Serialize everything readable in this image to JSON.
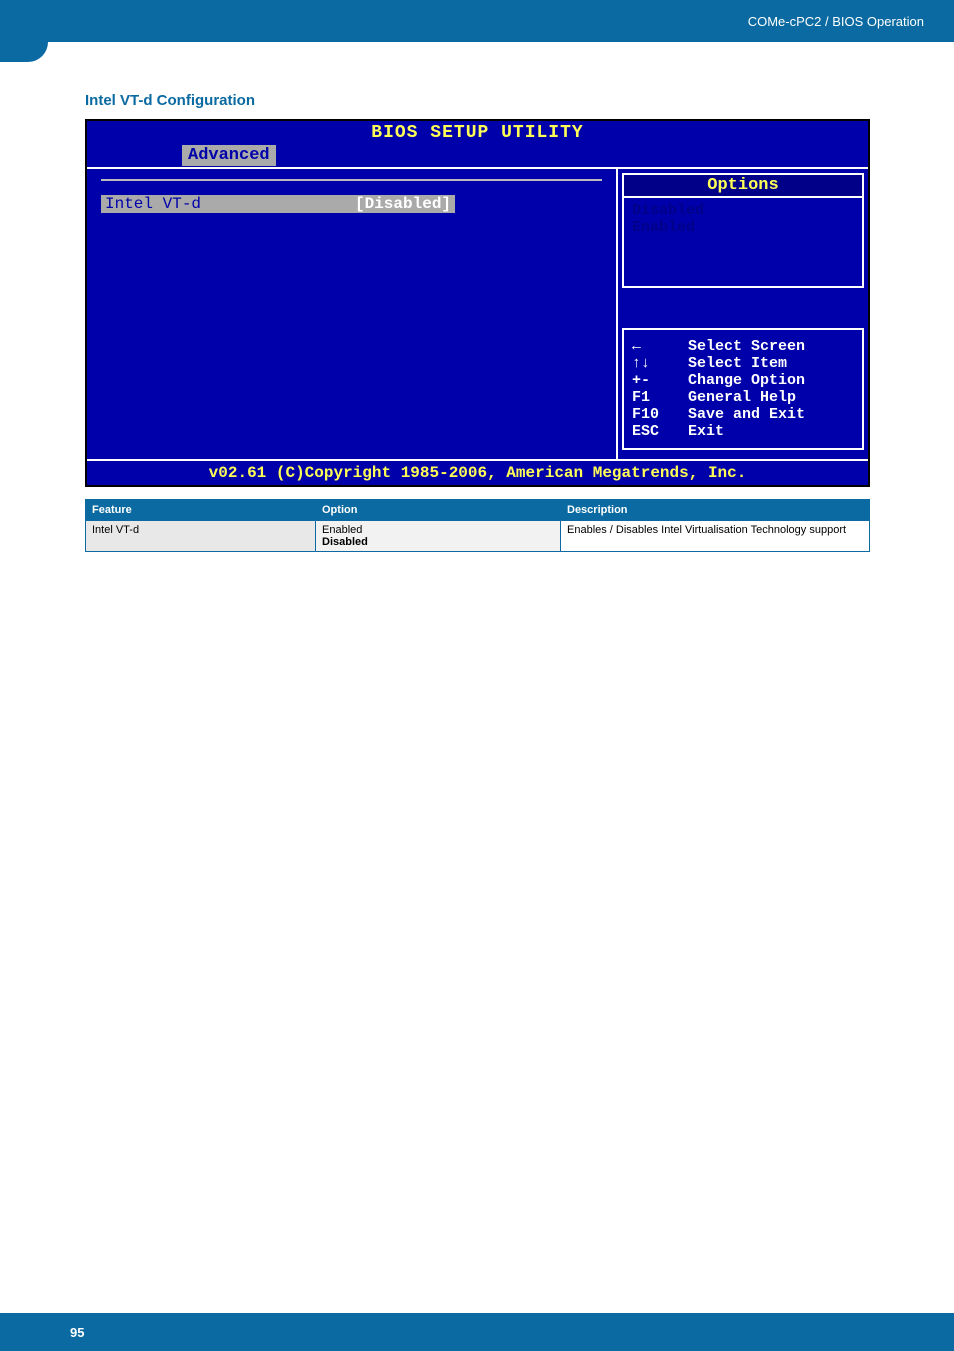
{
  "header": {
    "breadcrumb": "COMe-cPC2 / BIOS Operation"
  },
  "section": {
    "title": "Intel VT-d Configuration"
  },
  "bios": {
    "title": "BIOS SETUP UTILITY",
    "active_tab": "Advanced",
    "setting": {
      "label": "Intel VT-d",
      "value": "[Disabled]"
    },
    "options_header": "Options",
    "options": [
      "Disabled",
      "Enabled"
    ],
    "help": [
      {
        "key": "←",
        "text": "Select Screen"
      },
      {
        "key": "↑↓",
        "text": "Select Item"
      },
      {
        "key": "+-",
        "text": "Change Option"
      },
      {
        "key": "F1",
        "text": "General Help"
      },
      {
        "key": "F10",
        "text": "Save and Exit"
      },
      {
        "key": "ESC",
        "text": "Exit"
      }
    ],
    "footer": "v02.61 (C)Copyright 1985-2006, American Megatrends, Inc."
  },
  "table": {
    "headers": {
      "feature": "Feature",
      "option": "Option",
      "description": "Description"
    },
    "rows": [
      {
        "feature": "Intel VT-d",
        "option_line1": "Enabled",
        "option_line2_bold": "Disabled",
        "description": "Enables / Disables Intel Virtualisation Technology support"
      }
    ]
  },
  "footer": {
    "page_number": "95"
  }
}
